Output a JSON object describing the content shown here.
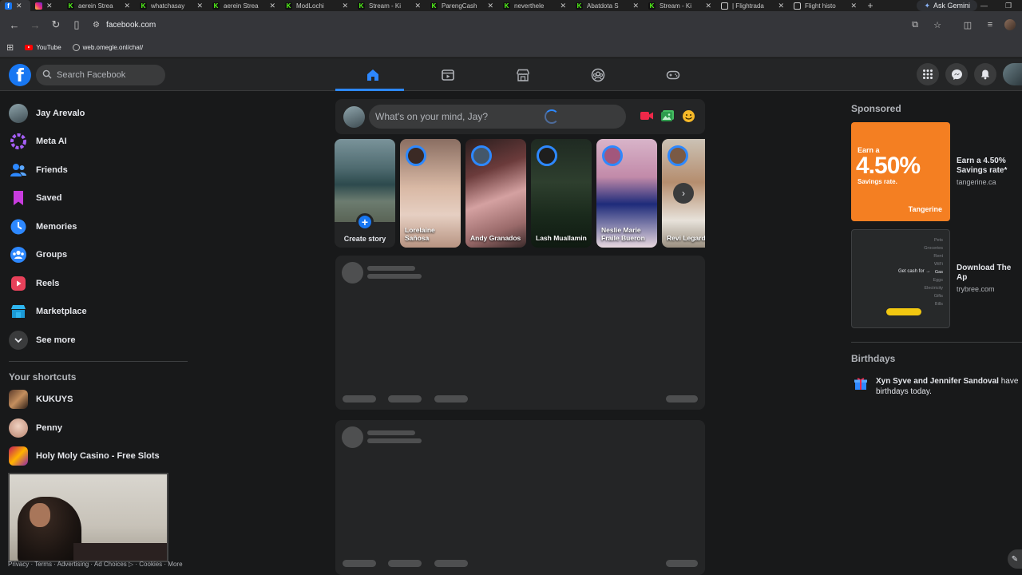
{
  "browser": {
    "tabs": [
      {
        "label": "",
        "icon": "facebook-icon",
        "active": true
      },
      {
        "label": "",
        "icon": "instagram-icon"
      },
      {
        "label": "aerein Strea",
        "icon": "kick-icon"
      },
      {
        "label": "whatchasay",
        "icon": "kick-icon"
      },
      {
        "label": "aerein Strea",
        "icon": "kick-icon"
      },
      {
        "label": "ModLochi",
        "icon": "kick-icon"
      },
      {
        "label": "Stream - Ki",
        "icon": "kick-icon"
      },
      {
        "label": "ParengCash",
        "icon": "kick-icon"
      },
      {
        "label": "neverthele",
        "icon": "kick-icon"
      },
      {
        "label": "Abatdota S",
        "icon": "kick-icon"
      },
      {
        "label": "Stream - Ki",
        "icon": "kick-icon"
      },
      {
        "label": "| Flightrada",
        "icon": "globe-icon"
      },
      {
        "label": "Flight histo",
        "icon": "globe-icon"
      }
    ],
    "gemini_label": "Ask Gemini",
    "url": "facebook.com",
    "bookmarks": [
      {
        "label": "YouTube",
        "icon": "youtube-icon"
      },
      {
        "label": "web.omegle.onl/chat/",
        "icon": "globe-icon"
      }
    ]
  },
  "fb": {
    "search_placeholder": "Search Facebook",
    "nav_tabs": [
      "home",
      "video",
      "marketplace",
      "groups",
      "gaming"
    ]
  },
  "sidebar": {
    "items": [
      {
        "label": "Jay Arevalo",
        "icon": "profile-avatar"
      },
      {
        "label": "Meta AI",
        "icon": "meta-ai-icon"
      },
      {
        "label": "Friends",
        "icon": "friends-icon"
      },
      {
        "label": "Saved",
        "icon": "saved-icon"
      },
      {
        "label": "Memories",
        "icon": "memories-icon"
      },
      {
        "label": "Groups",
        "icon": "groups-icon"
      },
      {
        "label": "Reels",
        "icon": "reels-icon"
      },
      {
        "label": "Marketplace",
        "icon": "marketplace-icon"
      },
      {
        "label": "See more",
        "icon": "chevron-down-icon"
      }
    ],
    "shortcuts_title": "Your shortcuts",
    "shortcuts": [
      {
        "label": "KUKUYS"
      },
      {
        "label": "Penny"
      },
      {
        "label": "Holy Moly Casino - Free Slots"
      }
    ],
    "footer": "Privacy · Terms · Advertising · Ad Choices ▷ · Cookies · More"
  },
  "composer": {
    "placeholder": "What's on your mind, Jay?"
  },
  "stories": {
    "create_label": "Create story",
    "items": [
      {
        "name": "Lorelaine Sañosa"
      },
      {
        "name": "Andy Granados"
      },
      {
        "name": "Lash Muallamin"
      },
      {
        "name": "Neslie Marie Fraile Bueron"
      },
      {
        "name": "Revi Legard"
      }
    ]
  },
  "right": {
    "sponsored_title": "Sponsored",
    "ads": [
      {
        "title": "Earn a 4.50% Savings rate*",
        "domain": "tangerine.ca",
        "img_earn": "Earn a",
        "img_big": "4.50%",
        "img_rate": "Savings rate.",
        "img_brand": "Tangerine"
      },
      {
        "title": "Download The Ap",
        "domain": "trybree.com",
        "img_list": [
          "Pets",
          "Groceries",
          "Rent",
          "WiFi",
          "Gas",
          "Eggs",
          "Electricity",
          "Gifts",
          "Bills"
        ],
        "img_cash": "Get cash for →"
      }
    ],
    "birthdays_title": "Birthdays",
    "birthday_names": "Xyn Syve and Jennifer Sandoval",
    "birthday_suffix": " have birthdays today."
  },
  "colors": {
    "accent": "#2d88ff",
    "fb_blue": "#1877f2",
    "bg": "#18191a",
    "card": "#242526"
  }
}
